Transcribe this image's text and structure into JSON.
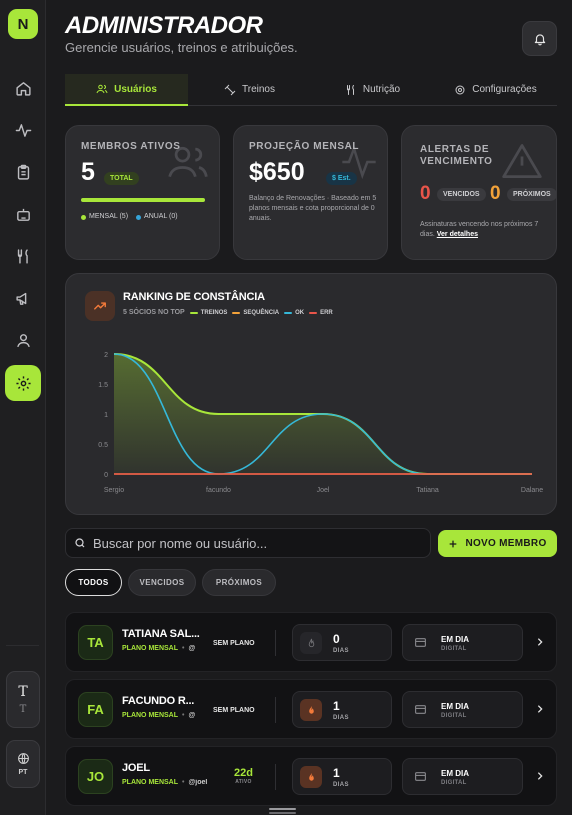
{
  "sidebar": {
    "logo_letter": "N",
    "items": [
      {
        "icon": "home-icon"
      },
      {
        "icon": "activity-icon"
      },
      {
        "icon": "clipboard-icon"
      },
      {
        "icon": "robot-icon"
      },
      {
        "icon": "utensils-icon"
      },
      {
        "icon": "megaphone-icon"
      },
      {
        "icon": "user-icon"
      },
      {
        "icon": "gear-icon",
        "active": true
      }
    ],
    "font_size_big": "T",
    "font_size_small": "T",
    "language": "PT"
  },
  "header": {
    "title": "ADMINISTRADOR",
    "subtitle": "Gerencie usuários, treinos e atribuições."
  },
  "tabs": [
    {
      "label": "Usuários",
      "icon": "users-icon",
      "active": true
    },
    {
      "label": "Treinos",
      "icon": "dumbbell-icon"
    },
    {
      "label": "Nutrição",
      "icon": "utensils-icon"
    },
    {
      "label": "Configurações",
      "icon": "gear-icon"
    }
  ],
  "stats": {
    "members": {
      "label": "MEMBROS ATIVOS",
      "value": "5",
      "badge": "TOTAL",
      "legend_monthly": "MENSAL (5)",
      "legend_annual": "ANUAL (0)",
      "monthly_fraction": 1.0
    },
    "projection": {
      "label": "PROJEÇÃO MENSAL",
      "value": "$650",
      "badge": "$ Est.",
      "description": "Balanço de Renovações · Baseado em 5 planos mensais e cota proporcional de 0 anuais."
    },
    "alerts": {
      "label_line1": "ALERTAS DE",
      "label_line2": "VENCIMENTO",
      "expired_count": "0",
      "expired_label": "VENCIDOS",
      "upcoming_count": "0",
      "upcoming_label": "PRÓXIMOS",
      "description": "Assinaturas vencendo nos próximos 7 dias.",
      "link": "Ver detalhes"
    }
  },
  "chart": {
    "title": "RANKING DE CONSTÂNCIA",
    "subtitle": "5 SÓCIOS NO TOP"
  },
  "chart_data": {
    "type": "area",
    "categories": [
      "Sergio",
      "facundo",
      "Joel",
      "Tatiana",
      "Dalane"
    ],
    "ylim": [
      0,
      2
    ],
    "yticks": [
      "0",
      "0.5",
      "1",
      "1.5",
      "2"
    ],
    "series": [
      {
        "name": "TREINOS",
        "color": "#a8e63a",
        "values": [
          2,
          1,
          1,
          0,
          0
        ]
      },
      {
        "name": "SEQUÊNCIA",
        "color": "#f2a23a",
        "values": [
          0,
          0,
          0,
          0,
          0
        ]
      },
      {
        "name": "OK",
        "color": "#35b8d8",
        "values": [
          2,
          0,
          1,
          0,
          0
        ]
      },
      {
        "name": "ERR",
        "color": "#e8554a",
        "values": [
          0,
          0,
          0,
          0,
          0
        ]
      }
    ]
  },
  "search": {
    "placeholder": "Buscar por nome ou usuário..."
  },
  "new_member_label": "NOVO MEMBRO",
  "filters": [
    {
      "label": "TODOS",
      "active": true
    },
    {
      "label": "VENCIDOS"
    },
    {
      "label": "PRÓXIMOS"
    }
  ],
  "members": [
    {
      "initials": "TA",
      "name": "TATIANA SAL...",
      "plan": "PLANO MENSAL",
      "username": "@...",
      "status": "SEM PLANO",
      "streak": "0",
      "streak_label": "DIAS",
      "streak_active": false,
      "payment_status": "EM DIA",
      "payment_type": "DIGITAL"
    },
    {
      "initials": "FA",
      "name": "FACUNDO R...",
      "plan": "PLANO MENSAL",
      "username": "@...",
      "status": "SEM PLANO",
      "streak": "1",
      "streak_label": "DIAS",
      "streak_active": true,
      "payment_status": "EM DIA",
      "payment_type": "DIGITAL"
    },
    {
      "initials": "JO",
      "name": "JOEL",
      "plan": "PLANO MENSAL",
      "username": "@joel",
      "days": "22d",
      "days_label": "ATIVO",
      "streak": "1",
      "streak_label": "DIAS",
      "streak_active": true,
      "payment_status": "EM DIA",
      "payment_type": "DIGITAL"
    }
  ]
}
